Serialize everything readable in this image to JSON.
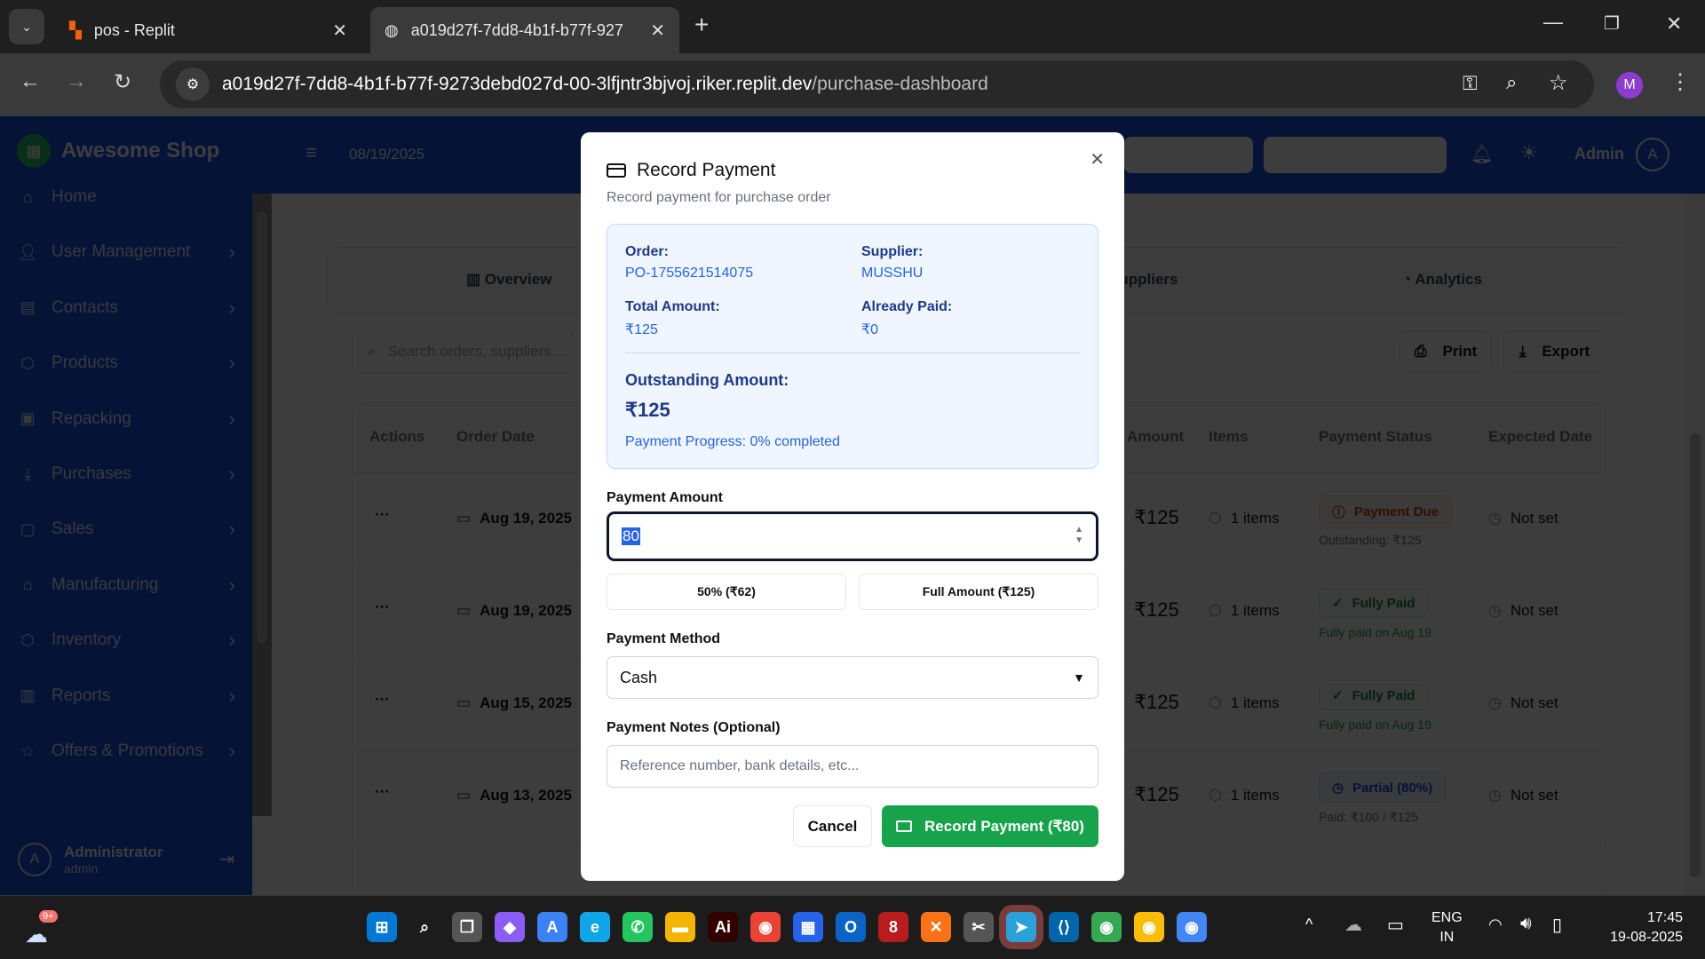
{
  "browser": {
    "tabs": [
      {
        "title": "pos - Replit",
        "active": false
      },
      {
        "title": "a019d27f-7dd8-4b1f-b77f-927",
        "active": true
      }
    ],
    "url_host": "a019d27f-7dd8-4b1f-b77f-9273debd027d-00-3lfjntr3bjvoj.riker.replit.dev",
    "url_path": "/purchase-dashboard",
    "profile_initial": "M"
  },
  "app": {
    "brand": "Awesome Shop",
    "date": "08/19/2025",
    "user_label": "Admin",
    "user_initial": "A",
    "sidebar": {
      "items": [
        {
          "label": "Home",
          "icon": "home-icon",
          "chevron": false
        },
        {
          "label": "User Management",
          "icon": "user-icon",
          "chevron": true
        },
        {
          "label": "Contacts",
          "icon": "contacts-icon",
          "chevron": true
        },
        {
          "label": "Products",
          "icon": "box-icon",
          "chevron": true
        },
        {
          "label": "Repacking",
          "icon": "repack-icon",
          "chevron": true
        },
        {
          "label": "Purchases",
          "icon": "download-icon",
          "chevron": true
        },
        {
          "label": "Sales",
          "icon": "bag-icon",
          "chevron": true
        },
        {
          "label": "Manufacturing",
          "icon": "factory-icon",
          "chevron": true
        },
        {
          "label": "Inventory",
          "icon": "package-icon",
          "chevron": true
        },
        {
          "label": "Reports",
          "icon": "chart-icon",
          "chevron": true
        },
        {
          "label": "Offers & Promotions",
          "icon": "star-icon",
          "chevron": true
        }
      ],
      "footer": {
        "name": "Administrator",
        "role": "admin",
        "initial": "A"
      }
    },
    "tabs": [
      "Overview",
      "Suppliers",
      "Analytics"
    ],
    "search_placeholder": "Search orders, suppliers...",
    "print_label": "Print",
    "export_label": "Export",
    "table": {
      "headers": {
        "actions": "Actions",
        "order_date": "Order Date",
        "amount": "Amount",
        "items": "Items",
        "payment_status": "Payment Status",
        "expected_date": "Expected Date"
      },
      "rows": [
        {
          "date": "Aug 19, 2025",
          "amount": "₹125",
          "items": "1 items",
          "status": "Payment Due",
          "status_type": "due",
          "status_note": "Outstanding: ₹125",
          "expected": "Not set"
        },
        {
          "date": "Aug 19, 2025",
          "amount": "₹125",
          "items": "1 items",
          "status": "Fully Paid",
          "status_type": "paid",
          "status_note": "Fully paid on Aug 19",
          "expected": "Not set"
        },
        {
          "date": "Aug 15, 2025",
          "amount": "₹125",
          "items": "1 items",
          "status": "Fully Paid",
          "status_type": "paid",
          "status_note": "Fully paid on Aug 19",
          "expected": "Not set"
        },
        {
          "date": "Aug 13, 2025",
          "amount": "₹125",
          "items": "1 items",
          "status": "Partial (80%)",
          "status_type": "partial",
          "status_note": "Paid: ₹100 / ₹125",
          "expected": "Not set"
        }
      ]
    }
  },
  "modal": {
    "title": "Record Payment",
    "subtitle": "Record payment for purchase order",
    "order_label": "Order:",
    "order_value": "PO-1755621514075",
    "supplier_label": "Supplier:",
    "supplier_value": "MUSSHU",
    "total_label": "Total Amount:",
    "total_value": "₹125",
    "paid_label": "Already Paid:",
    "paid_value": "₹0",
    "outstanding_label": "Outstanding Amount:",
    "outstanding_value": "₹125",
    "progress_text": "Payment Progress: 0% completed",
    "progress_percent": 0,
    "amount_label": "Payment Amount",
    "amount_value": "80",
    "half_button": "50% (₹62)",
    "full_button": "Full Amount (₹125)",
    "method_label": "Payment Method",
    "method_value": "Cash",
    "notes_label": "Payment Notes (Optional)",
    "notes_placeholder": "Reference number, bank details, etc...",
    "cancel_label": "Cancel",
    "submit_label": "Record Payment (₹80)"
  },
  "taskbar": {
    "notification_badge": "9+",
    "lang_line1": "ENG",
    "lang_line2": "IN",
    "time": "17:45",
    "date": "19-08-2025"
  },
  "colors": {
    "primary": "#16a34a",
    "info_bg": "#eff6ff",
    "info_text": "#1e3a8a",
    "link_blue": "#2563eb"
  }
}
